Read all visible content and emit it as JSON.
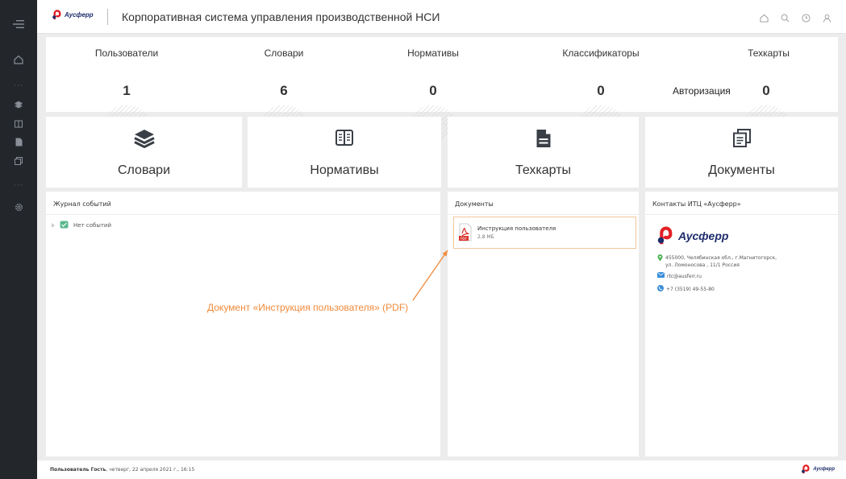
{
  "header": {
    "logo_text": "Аусферр",
    "title": "Корпоративная система управления производственной НСИ",
    "icons": [
      "home-icon",
      "search-icon",
      "clock-icon",
      "user-icon"
    ]
  },
  "sidebar": {
    "icons": [
      "menu-icon",
      "home-icon",
      "layers-icon",
      "book-icon",
      "file-icon",
      "documents-icon",
      "gear-icon"
    ],
    "dots": "···"
  },
  "stats": [
    {
      "label": "Пользователи",
      "value": "1"
    },
    {
      "label": "Словари",
      "value": "6"
    },
    {
      "label": "Нормативы",
      "value": "0"
    },
    {
      "label": "Классификаторы",
      "value": "0"
    },
    {
      "label": "Техкарты",
      "value": "0"
    }
  ],
  "auth_label": "Авторизация",
  "tiles": [
    {
      "label": "Словари",
      "icon": "layers-icon"
    },
    {
      "label": "Нормативы",
      "icon": "book-icon"
    },
    {
      "label": "Техкарты",
      "icon": "file-icon"
    },
    {
      "label": "Документы",
      "icon": "documents-icon"
    }
  ],
  "events": {
    "title": "Журнал событий",
    "empty": "Нет событий"
  },
  "documents": {
    "title": "Документы",
    "items": [
      {
        "name": "Инструкция пользователя",
        "size": "2,8 МБ",
        "badge": "PDF"
      }
    ]
  },
  "contacts": {
    "title": "Контакты ИТЦ «Аусферр»",
    "logo_text": "Аусферр",
    "address_line1": "455000, Челябинская обл., г.Магнитогорск,",
    "address_line2": "ул. Ломоносова , 11/1 Россия",
    "email": "rtc@ausferr.ru",
    "phone": "+7 (3519) 49-55-80"
  },
  "annotation": "Документ «Инструкция пользователя» (PDF)",
  "footer": {
    "user_label": "Пользователь Гость",
    "date": ", четверг, 22 апреля 2021 г., 16:15",
    "logo_text": "Аусферр"
  },
  "colors": {
    "sidebar": "#23262b",
    "brand_red": "#e21f26",
    "brand_navy": "#1e2d6b",
    "accent_orange": "#f08a3a",
    "icon_dark": "#3a3f47"
  }
}
